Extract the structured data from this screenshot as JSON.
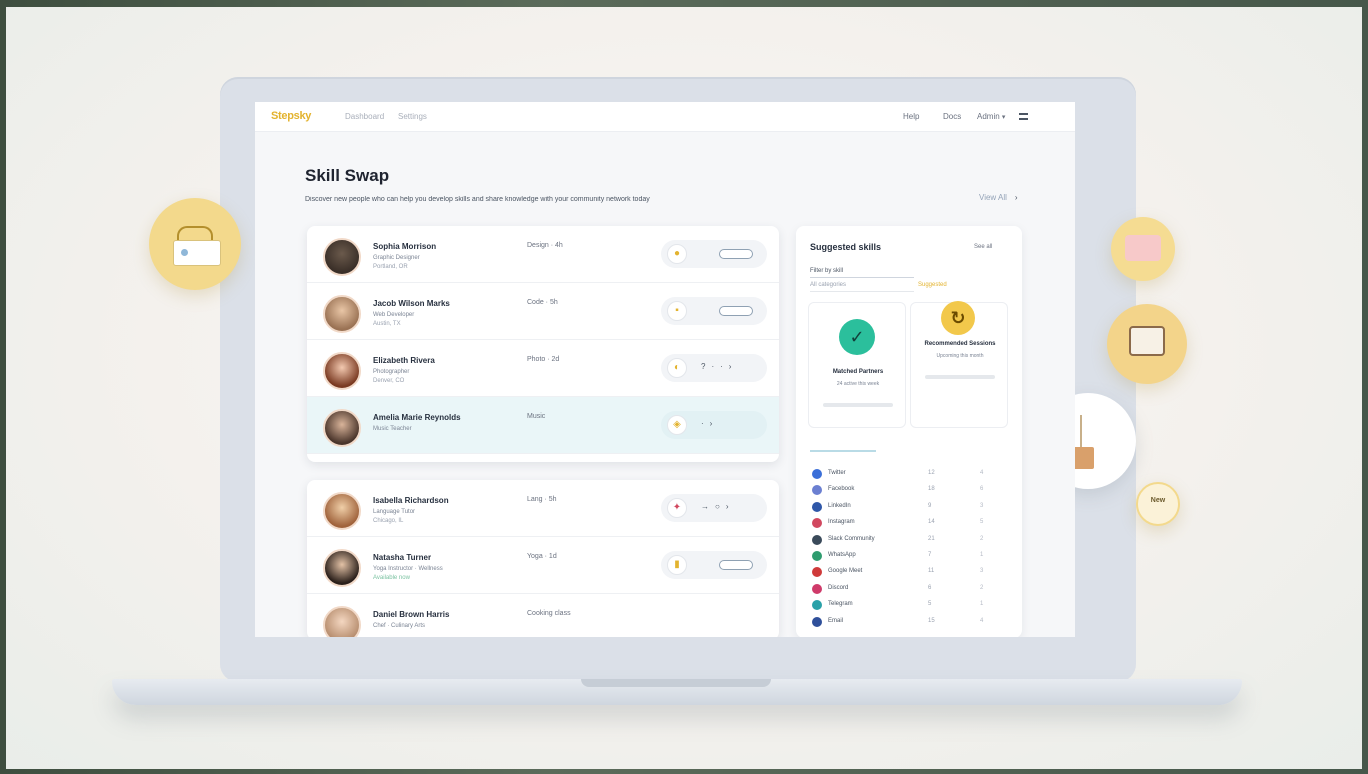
{
  "nav": {
    "logo": "Stepsky",
    "links": [
      "Dashboard",
      "Settings"
    ],
    "right": [
      "Help",
      "Docs",
      "Admin"
    ],
    "menu_label": "Menu"
  },
  "page": {
    "title": "Skill Swap",
    "subtitle": "Discover new people who can help you develop skills and share knowledge with your community network today",
    "view_all": "View All"
  },
  "people": [
    {
      "name": "Sophia Morrison",
      "sub": "Graphic Designer",
      "sub2": "Portland, OR",
      "meta": "Design · 4h",
      "action": "pill"
    },
    {
      "name": "Jacob Wilson Marks",
      "sub": "Web Developer",
      "sub2": "Austin, TX",
      "meta": "Code · 5h",
      "action": "pill"
    },
    {
      "name": "Elizabeth Rivera",
      "sub": "Photographer",
      "sub2": "Denver, CO",
      "meta": "Photo · 2d",
      "action": "dots"
    },
    {
      "name": "Amelia Marie Reynolds",
      "sub": "Music Teacher",
      "sub2": "",
      "meta": "Music",
      "action": "dots"
    },
    {
      "name": "Isabella Richardson",
      "sub": "Language Tutor",
      "sub2": "Chicago, IL",
      "meta": "Lang · 5h",
      "action": "dots"
    },
    {
      "name": "Natasha Turner",
      "sub": "Yoga Instructor · Wellness",
      "sub2": "Available now",
      "meta": "Yoga · 1d",
      "action": "pill"
    },
    {
      "name": "Daniel Brown Harris",
      "sub": "Chef · Culinary Arts",
      "sub2": "",
      "meta": "Cooking class",
      "action": "none"
    }
  ],
  "panel": {
    "title": "Suggested skills",
    "link": "See all",
    "field_label": "Filter by skill",
    "field_value": "All categories",
    "hint": "Suggested",
    "stat_a": {
      "label": "Matched Partners",
      "note": "24 active this week",
      "badge": "✓"
    },
    "stat_b": {
      "label": "Recommended Sessions",
      "note": "Upcoming this month",
      "badge": "↻"
    },
    "contacts": [
      {
        "label": "Twitter",
        "val": "12",
        "num": "4",
        "color": "#3b6fd8"
      },
      {
        "label": "Facebook",
        "val": "18",
        "num": "6",
        "color": "#6b7fd1"
      },
      {
        "label": "LinkedIn",
        "val": "9",
        "num": "3",
        "color": "#2f57a8"
      },
      {
        "label": "Instagram",
        "val": "14",
        "num": "5",
        "color": "#d1485f"
      },
      {
        "label": "Slack Community",
        "val": "21",
        "num": "2",
        "color": "#3a4a5a"
      },
      {
        "label": "WhatsApp",
        "val": "7",
        "num": "1",
        "color": "#2e9c6f"
      },
      {
        "label": "Google Meet",
        "val": "11",
        "num": "3",
        "color": "#cf3a3a"
      },
      {
        "label": "Discord",
        "val": "6",
        "num": "2",
        "color": "#cf3a6a"
      },
      {
        "label": "Telegram",
        "val": "5",
        "num": "1",
        "color": "#2aa1a8"
      },
      {
        "label": "Email",
        "val": "15",
        "num": "4",
        "color": "#2f4f9a"
      }
    ]
  },
  "bubbles": {
    "badge_label": "New"
  }
}
